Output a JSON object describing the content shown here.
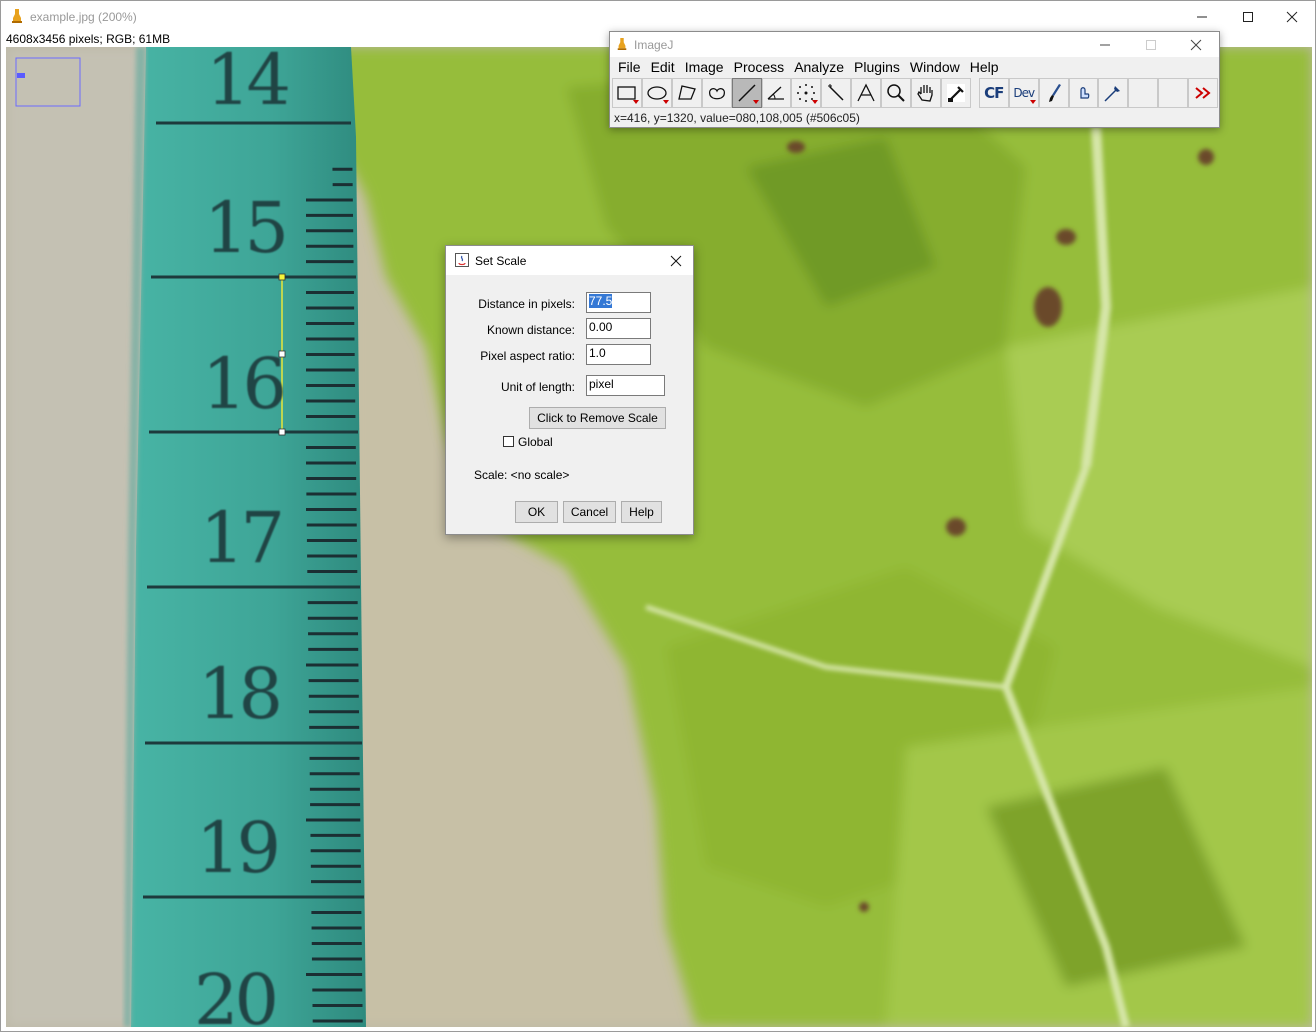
{
  "image_window": {
    "title": "example.jpg (200%)",
    "info": "4608x3456 pixels; RGB; 61MB",
    "controls": [
      "minimize-icon",
      "maximize-icon",
      "close-icon"
    ]
  },
  "ruler": {
    "numbers": [
      "14",
      "15",
      "16",
      "17",
      "18",
      "19",
      "20"
    ]
  },
  "imagej_window": {
    "title": "ImageJ",
    "menu": [
      "File",
      "Edit",
      "Image",
      "Process",
      "Analyze",
      "Plugins",
      "Window",
      "Help"
    ],
    "tools": [
      {
        "name": "rectangle-tool",
        "icon": "rectangle-icon"
      },
      {
        "name": "oval-tool",
        "icon": "oval-icon"
      },
      {
        "name": "polygon-tool",
        "icon": "polygon-icon"
      },
      {
        "name": "freehand-tool",
        "icon": "freehand-icon"
      },
      {
        "name": "line-tool",
        "icon": "line-icon",
        "selected": true
      },
      {
        "name": "angle-tool",
        "icon": "angle-icon"
      },
      {
        "name": "point-tool",
        "icon": "point-icon"
      },
      {
        "name": "wand-tool",
        "icon": "wand-icon"
      },
      {
        "name": "text-tool",
        "icon": "text-icon"
      },
      {
        "name": "magnifier-tool",
        "icon": "magnifier-icon"
      },
      {
        "name": "hand-tool",
        "icon": "hand-icon"
      },
      {
        "name": "dropper-tool",
        "icon": "dropper-icon"
      },
      {
        "name": "cf-tool",
        "label": "CF"
      },
      {
        "name": "dev-tool",
        "label": "Dev"
      },
      {
        "name": "brush-tool",
        "icon": "brush-icon"
      },
      {
        "name": "arrow-tool",
        "icon": "arrow-icon"
      },
      {
        "name": "pencil-tool",
        "icon": "pencil-icon"
      },
      {
        "name": "more-tools",
        "icon": "double-chevron-icon"
      }
    ],
    "status": "x=416, y=1320, value=080,108,005 (#506c05)"
  },
  "set_scale_dialog": {
    "title": "Set Scale",
    "distance_label": "Distance in pixels:",
    "distance_value": "77.5",
    "known_label": "Known distance:",
    "known_value": "0.00",
    "aspect_label": "Pixel aspect ratio:",
    "aspect_value": "1.0",
    "unit_label": "Unit of length:",
    "unit_value": "pixel",
    "remove_button": "Click to Remove Scale",
    "global_label": "Global",
    "scale_text": "Scale: <no scale>",
    "ok_button": "OK",
    "cancel_button": "Cancel",
    "help_button": "Help"
  },
  "colors": {
    "ruler": "#3aa89b",
    "leaf": "#9cc23c",
    "background": "#bdb9a8",
    "selection_line": "#e8e83a"
  }
}
